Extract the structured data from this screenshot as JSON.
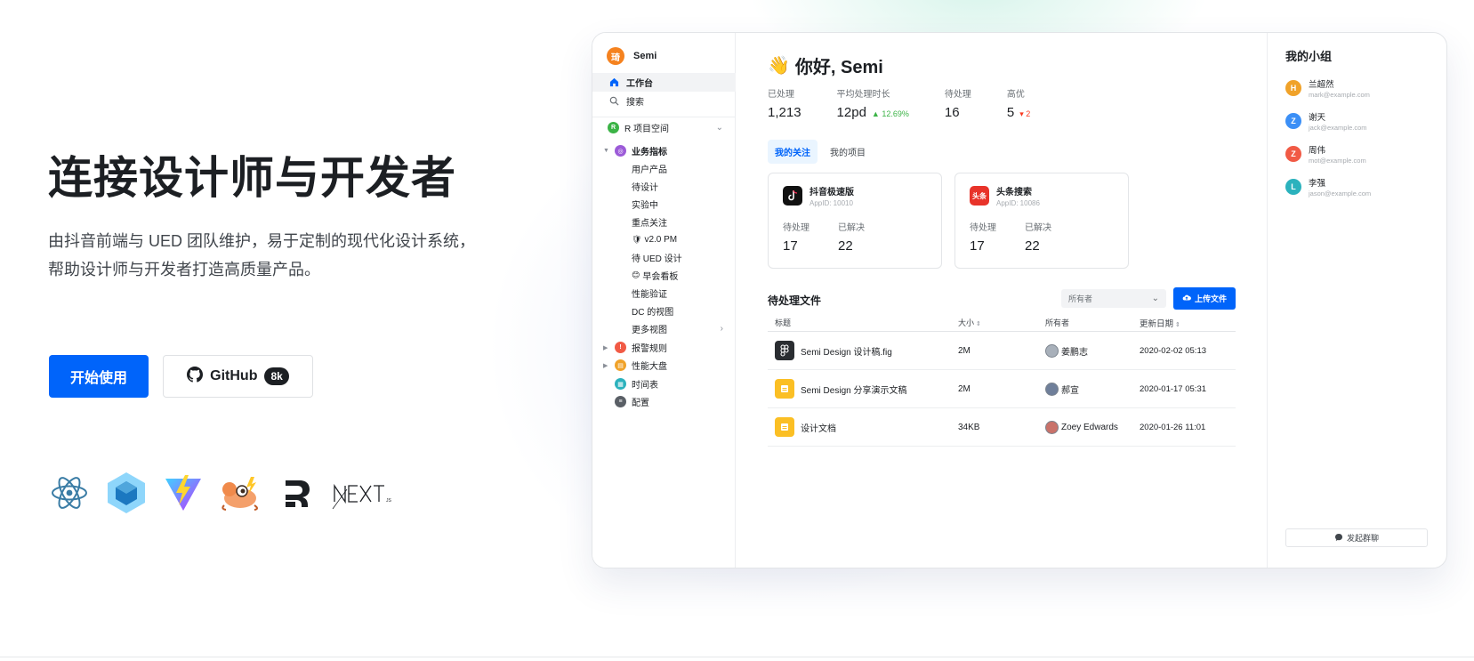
{
  "hero": {
    "title": "连接设计师与开发者",
    "desc_line1": "由抖音前端与 UED 团队维护，易于定制的现代化设计系统，",
    "desc_line2": "帮助设计师与开发者打造高质量产品。",
    "start_label": "开始使用",
    "github_label": "GitHub",
    "github_count": "8k",
    "tech_icons": [
      "react-icon",
      "webpack-icon",
      "vite-icon",
      "rspack-icon",
      "remix-icon",
      "nextjs-icon"
    ]
  },
  "app": {
    "brand": "Semi",
    "brand_logo": "琦",
    "nav": {
      "workbench": "工作台",
      "search": "搜索",
      "space": "R 项目空间",
      "space_badge": "R",
      "metrics": "业务指标",
      "metrics_children": [
        "用户产品",
        "待设计",
        "实验中",
        "重点关注",
        "v2.0 PM",
        "待 UED 设计",
        "早会看板",
        "性能验证",
        "DC 的视图",
        "更多视图"
      ],
      "alerts": "报警规则",
      "perf": "性能大盘",
      "timeline": "时间表",
      "config": "配置"
    },
    "greeting": "你好, Semi",
    "greeting_emoji": "👋",
    "stats": [
      {
        "label": "已处理",
        "value": "1,213"
      },
      {
        "label": "平均处理时长",
        "value": "12pd",
        "delta": "▲ 12.69%"
      },
      {
        "label": "待处理",
        "value": "16"
      },
      {
        "label": "高优",
        "value": "5",
        "delta": "▾ 2"
      }
    ],
    "tabs": [
      "我的关注",
      "我的项目"
    ],
    "cards": [
      {
        "name": "抖音极速版",
        "appid": "AppID: 10010",
        "pending_label": "待处理",
        "pending": "17",
        "resolved_label": "已解决",
        "resolved": "22"
      },
      {
        "name": "头条搜索",
        "appid": "AppID: 10086",
        "logo_text": "头条",
        "pending_label": "待处理",
        "pending": "17",
        "resolved_label": "已解决",
        "resolved": "22"
      }
    ],
    "files": {
      "title": "待处理文件",
      "owner_placeholder": "所有者",
      "upload_label": "上传文件",
      "columns": [
        "标题",
        "大小",
        "所有者",
        "更新日期"
      ],
      "rows": [
        {
          "title": "Semi Design 设计稿.fig",
          "size": "2M",
          "owner": "姜鹏志",
          "date": "2020-02-02 05:13",
          "type": "figma"
        },
        {
          "title": "Semi Design 分享演示文稿",
          "size": "2M",
          "owner": "郝宣",
          "date": "2020-01-17 05:31",
          "type": "doc"
        },
        {
          "title": "设计文档",
          "size": "34KB",
          "owner": "Zoey Edwards",
          "date": "2020-01-26 11:01",
          "type": "doc"
        }
      ]
    },
    "group": {
      "title": "我的小组",
      "members": [
        {
          "initial": "H",
          "name": "兰超然",
          "email": "mark@example.com",
          "color": "#f0a229"
        },
        {
          "initial": "Z",
          "name": "谢天",
          "email": "jack@example.com",
          "color": "#3b8ff6"
        },
        {
          "initial": "Z",
          "name": "周伟",
          "email": "mot@example.com",
          "color": "#f15a45"
        },
        {
          "initial": "L",
          "name": "李强",
          "email": "jason@example.com",
          "color": "#2bb2bd"
        }
      ],
      "chat_label": "发起群聊"
    }
  },
  "colors": {
    "primary": "#0064fa",
    "up": "#3bb346",
    "down": "#f93920"
  }
}
